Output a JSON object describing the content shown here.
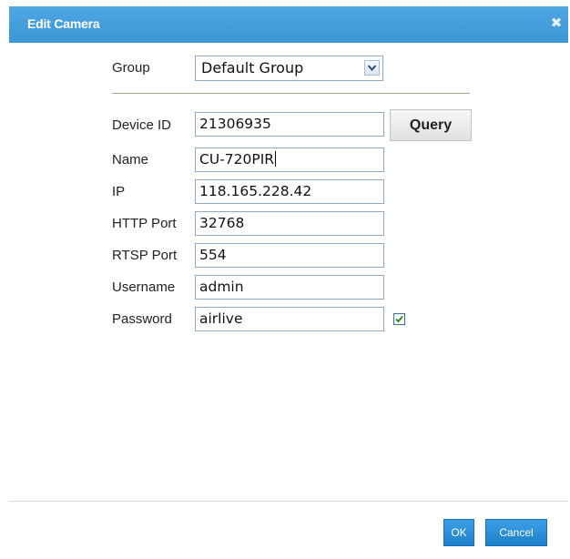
{
  "dialog": {
    "title": "Edit Camera"
  },
  "group": {
    "label": "Group",
    "selected": "Default Group"
  },
  "fields": {
    "device_id": {
      "label": "Device ID",
      "value": "21306935"
    },
    "name": {
      "label": "Name",
      "value": "CU-720PIR"
    },
    "ip": {
      "label": "IP",
      "value": "118.165.228.42"
    },
    "http_port": {
      "label": "HTTP Port",
      "value": "32768"
    },
    "rtsp_port": {
      "label": "RTSP Port",
      "value": "554"
    },
    "username": {
      "label": "Username",
      "value": "admin"
    },
    "password": {
      "label": "Password",
      "value": "airlive",
      "checkbox_checked": true
    }
  },
  "buttons": {
    "query": "Query",
    "ok": "OK",
    "cancel": "Cancel"
  },
  "icons": {
    "close": "close-icon",
    "dropdown": "chevron-down-icon",
    "check": "checkmark-icon"
  },
  "colors": {
    "titlebar": "#3b96d6",
    "button": "#2a8fd9",
    "check": "#2e8b2e"
  }
}
